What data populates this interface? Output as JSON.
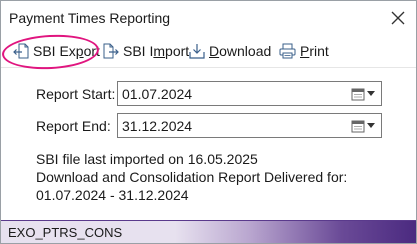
{
  "window": {
    "title": "Payment Times Reporting",
    "close_icon": "close-icon"
  },
  "toolbar": {
    "sbi_export": {
      "prefix": "SBI Ex",
      "underlined": "p",
      "suffix": "ort",
      "icon": "export-icon"
    },
    "sbi_import": {
      "prefix": "SBI I",
      "underlined": "m",
      "suffix": "port",
      "icon": "import-icon"
    },
    "download": {
      "prefix": "",
      "underlined": "D",
      "suffix": "ownload",
      "icon": "download-icon"
    },
    "print": {
      "prefix": "",
      "underlined": "P",
      "suffix": "rint",
      "icon": "printer-icon"
    },
    "highlight_color": "#e0157f"
  },
  "form": {
    "report_start": {
      "label": "Report Start:",
      "value": "01.07.2024",
      "icon": "calendar-icon"
    },
    "report_end": {
      "label": "Report End:",
      "value": "31.12.2024",
      "icon": "calendar-icon"
    }
  },
  "info": {
    "line1": "SBI file last imported on 16.05.2025",
    "line2": "Download and Consolidation Report Delivered for:",
    "line3": "01.07.2024 - 31.12.2024"
  },
  "status": {
    "text": "EXO_PTRS_CONS",
    "accent_color": "#4b2a80"
  }
}
